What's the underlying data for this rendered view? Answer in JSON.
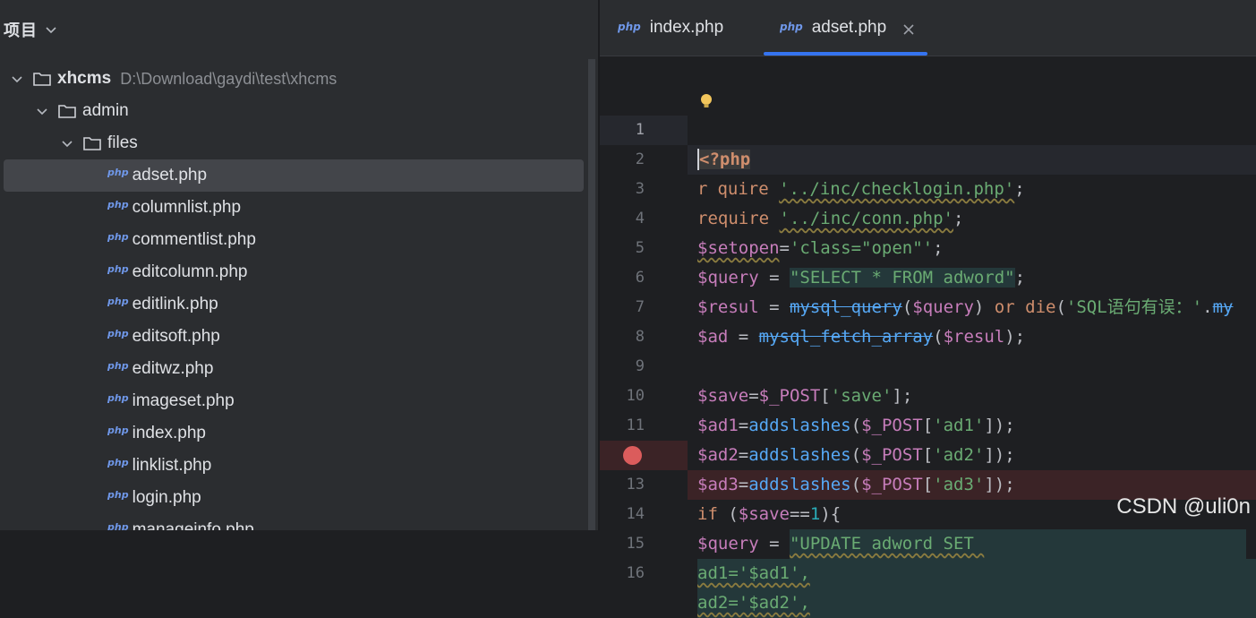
{
  "project_panel": {
    "title": "项目",
    "root": {
      "name": "xhcms",
      "path": "D:\\Download\\gaydi\\test\\xhcms"
    },
    "folders": [
      "admin",
      "files"
    ],
    "files": [
      "adset.php",
      "columnlist.php",
      "commentlist.php",
      "editcolumn.php",
      "editlink.php",
      "editsoft.php",
      "editwz.php",
      "imageset.php",
      "index.php",
      "linklist.php",
      "login.php",
      "manageinfo.php"
    ],
    "selected_file": "adset.php",
    "php_badge": "php"
  },
  "editor": {
    "tabs": [
      {
        "label": "index.php",
        "active": false
      },
      {
        "label": "adset.php",
        "active": true
      }
    ],
    "current_line": 1,
    "breakpoint_line": 12,
    "lines": [
      {
        "n": "1"
      },
      {
        "n": "2"
      },
      {
        "n": "3"
      },
      {
        "n": "4"
      },
      {
        "n": "5"
      },
      {
        "n": "6"
      },
      {
        "n": "7"
      },
      {
        "n": "8"
      },
      {
        "n": "9"
      },
      {
        "n": "10"
      },
      {
        "n": "11"
      },
      {
        "n": "12"
      },
      {
        "n": "13"
      },
      {
        "n": "14"
      },
      {
        "n": "15"
      },
      {
        "n": "16"
      }
    ],
    "code": {
      "l1": "<?php",
      "l2a": "r",
      "l2b": "quire",
      "l2c": "'../inc/checklogin.php'",
      "l3a": "require",
      "l3b": "'../inc/conn.php'",
      "l4a": "$setopen",
      "l4b": "'class=\"open\"'",
      "l5a": "$query",
      "l5b": "\"SELECT * FROM adword\"",
      "l6a": "$resul",
      "l6b": "mysql_query",
      "l6c": "$query",
      "l6d": "or",
      "l6e": "die",
      "l6f": "'SQL语句有误：'",
      "l6g": "my",
      "l7a": "$ad",
      "l7b": "mysql_fetch_array",
      "l7c": "$resul",
      "l9a": "$save",
      "l9b": "$_POST",
      "l9c": "'save'",
      "l10a": "$ad1",
      "l10b": "addslashes",
      "l10c": "$_POST",
      "l10d": "'ad1'",
      "l11a": "$ad2",
      "l11b": "addslashes",
      "l11c": "$_POST",
      "l11d": "'ad2'",
      "l12a": "$ad3",
      "l12b": "addslashes",
      "l12c": "$_POST",
      "l12d": "'ad3'",
      "l13a": "if",
      "l13b": "$save",
      "l13c": "1",
      "l14a": "$query",
      "l14b": "\"UPDATE adword SET ",
      "l15a": "ad1='$ad1',",
      "l16a": "ad2='$ad2',"
    }
  },
  "watermark": "CSDN @uli0n",
  "colors": {
    "panel_bg": "#2b2d30",
    "editor_bg": "#1e1f22",
    "accent": "#3574f0",
    "breakpoint": "#db5c5c",
    "string": "#6aab73",
    "keyword": "#cf8e6d",
    "variable": "#c77dbb",
    "function": "#56a8f5"
  }
}
